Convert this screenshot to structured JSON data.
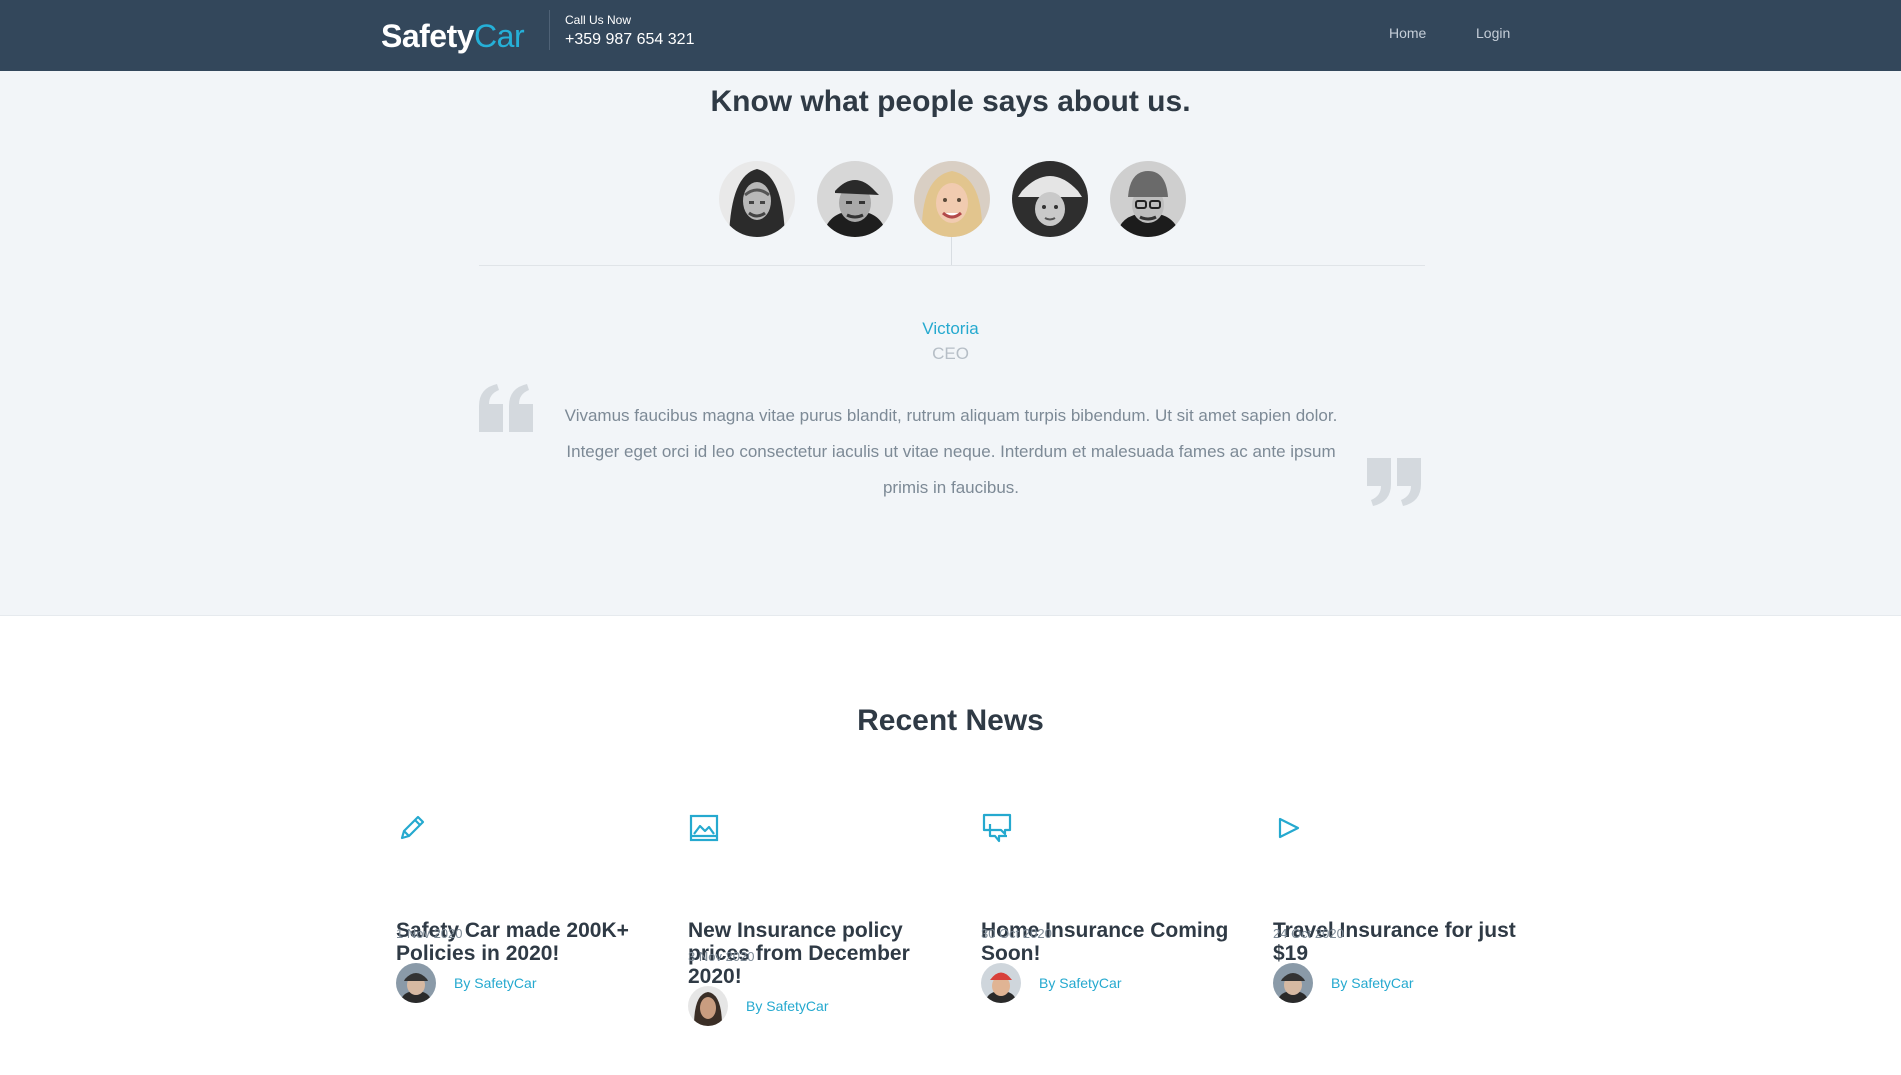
{
  "header": {
    "logo_part1": "Safety",
    "logo_part2": "Car",
    "call_label": "Call Us Now",
    "phone": "+359 987 654 321",
    "nav": [
      "Home",
      "Login"
    ]
  },
  "testimonials": {
    "title": "Know what people says about us.",
    "active_name": "Victoria",
    "active_role": "CEO",
    "quote": "Vivamus faucibus magna vitae purus blandit, rutrum aliquam turpis bibendum. Ut sit amet sapien dolor. Integer eget orci id leo consectetur iaculis ut vitae neque. Interdum et malesuada fames ac ante ipsum primis in faucibus.",
    "avatars": [
      "hooded-man-avatar",
      "cap-man-avatar",
      "blonde-woman-avatar",
      "hat-woman-avatar",
      "beanie-man-avatar"
    ]
  },
  "news": {
    "title": "Recent News",
    "items": [
      {
        "icon": "pencil-icon",
        "headline": "Safety Car made 200K+ Policies in 2020!",
        "date": "1 Nov 2020",
        "author": "By SafetyCar"
      },
      {
        "icon": "image-icon",
        "headline": "New Insurance policy prices from December 2020!",
        "date": "3 Nov 2020",
        "author": "By SafetyCar"
      },
      {
        "icon": "chat-icon",
        "headline": "Home Insurance Coming Soon!",
        "date": "30 Oct 2020",
        "author": "By SafetyCar"
      },
      {
        "icon": "play-icon",
        "headline": "Travel Insurance for just $19",
        "date": "24 Oct 2020",
        "author": "By SafetyCar"
      }
    ]
  },
  "colors": {
    "header_bg": "#33475b",
    "accent": "#25b0d8",
    "section_bg": "#f2f5f8"
  }
}
